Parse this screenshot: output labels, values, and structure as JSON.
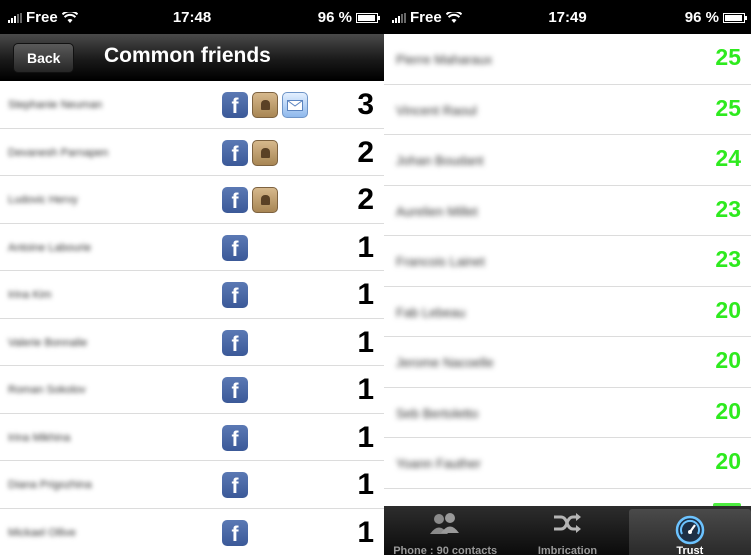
{
  "left": {
    "status": {
      "carrier": "Free",
      "time": "17:48",
      "battery": "96 %"
    },
    "nav": {
      "back_label": "Back",
      "title": "Common friends"
    },
    "rows": [
      {
        "name": "Stephanie Neuman",
        "sources": [
          "facebook-icon",
          "address-book-icon",
          "mail-icon"
        ],
        "count": "3"
      },
      {
        "name": "Devanesh Parnapen",
        "sources": [
          "facebook-icon",
          "address-book-icon"
        ],
        "count": "2"
      },
      {
        "name": "Ludovic Hervy",
        "sources": [
          "facebook-icon",
          "address-book-icon"
        ],
        "count": "2"
      },
      {
        "name": "Antoine Labourie",
        "sources": [
          "facebook-icon"
        ],
        "count": "1"
      },
      {
        "name": "Irina Kim",
        "sources": [
          "facebook-icon"
        ],
        "count": "1"
      },
      {
        "name": "Valerie Bonnalie",
        "sources": [
          "facebook-icon"
        ],
        "count": "1"
      },
      {
        "name": "Roman Sokolov",
        "sources": [
          "facebook-icon"
        ],
        "count": "1"
      },
      {
        "name": "Irina Mikhina",
        "sources": [
          "facebook-icon"
        ],
        "count": "1"
      },
      {
        "name": "Diana Prigozhina",
        "sources": [
          "facebook-icon"
        ],
        "count": "1"
      },
      {
        "name": "Mickael Ollive",
        "sources": [
          "facebook-icon"
        ],
        "count": "1"
      }
    ]
  },
  "right": {
    "status": {
      "carrier": "Free",
      "time": "17:49",
      "battery": "96 %"
    },
    "rows": [
      {
        "name": "Pierre Maharaux",
        "score": "25"
      },
      {
        "name": "Vincent Raoul",
        "score": "25"
      },
      {
        "name": "Johan Boudant",
        "score": "24"
      },
      {
        "name": "Aurelien Millet",
        "score": "23"
      },
      {
        "name": "Francois Lainet",
        "score": "23"
      },
      {
        "name": "Fab Lebeau",
        "score": "20"
      },
      {
        "name": "Jerome Nacoelle",
        "score": "20"
      },
      {
        "name": "Seb Bertoletto",
        "score": "20"
      },
      {
        "name": "Yoann Fauther",
        "score": "20"
      }
    ],
    "tabs": [
      {
        "label": "Phone : 90 contacts",
        "icon": "contacts-icon",
        "active": false
      },
      {
        "label": "Imbrication",
        "icon": "shuffle-icon",
        "active": false
      },
      {
        "label": "Trust",
        "icon": "speedometer-icon",
        "active": true
      }
    ]
  },
  "colors": {
    "score_green": "#2eea1e",
    "navbar": "#1a1a1a",
    "facebook_blue": "#3b5998"
  }
}
